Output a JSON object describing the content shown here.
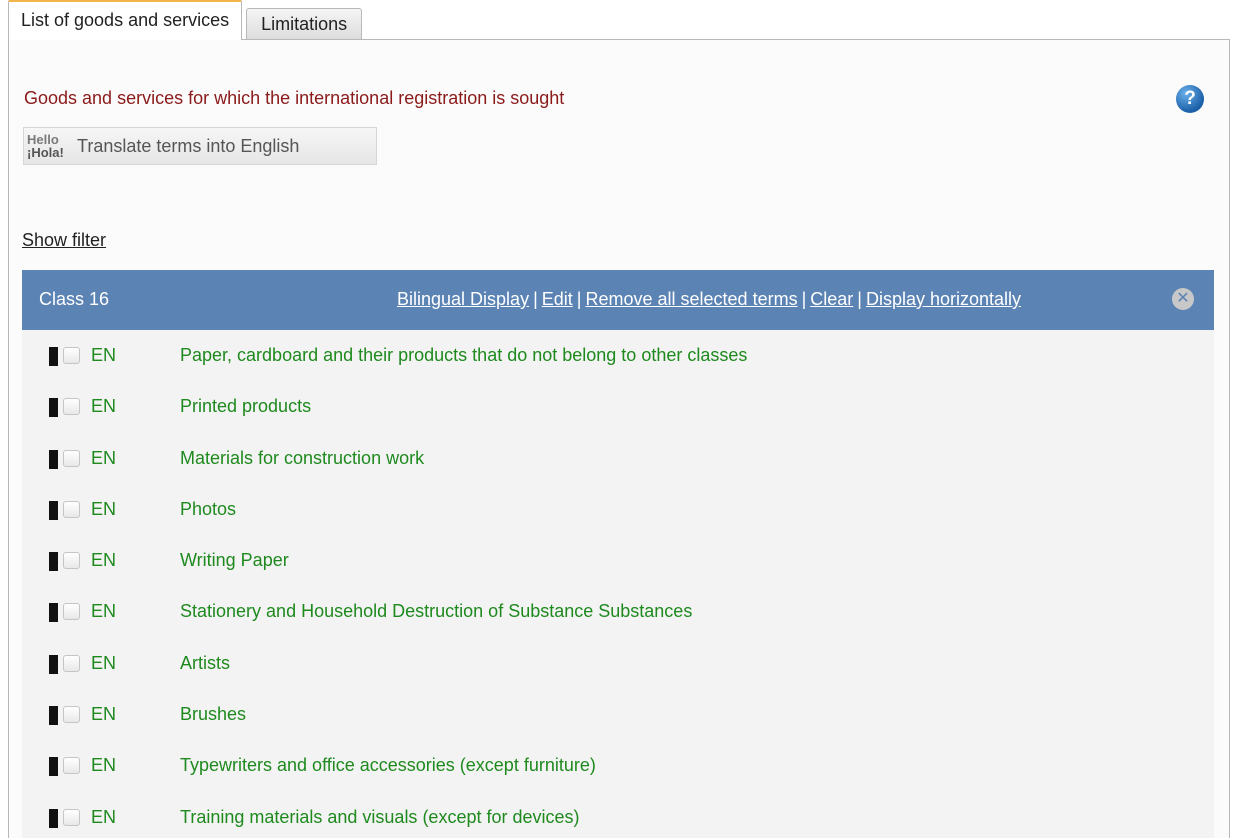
{
  "tabs": [
    {
      "label": "List of goods and services",
      "active": true
    },
    {
      "label": "Limitations",
      "active": false
    }
  ],
  "intro_text": "Goods and services for which the international registration is sought",
  "help_glyph": "?",
  "translate": {
    "icon_line1": "Hello",
    "icon_line2": "¡Hola!",
    "label": "Translate terms into English"
  },
  "show_filter": "Show filter",
  "class_bar": {
    "title": "Class 16",
    "actions": {
      "bilingual": "Bilingual Display",
      "edit": "Edit",
      "remove": "Remove all selected terms",
      "clear": "Clear",
      "horizontal": "Display horizontally"
    },
    "separator": "|",
    "close_glyph": "✕"
  },
  "terms": [
    {
      "lang": "EN",
      "text": "Paper, cardboard and their products that do not belong to other classes"
    },
    {
      "lang": "EN",
      "text": "Printed products"
    },
    {
      "lang": "EN",
      "text": "Materials for construction work"
    },
    {
      "lang": "EN",
      "text": "Photos"
    },
    {
      "lang": "EN",
      "text": "Writing Paper"
    },
    {
      "lang": "EN",
      "text": "Stationery and Household Destruction of Substance Substances"
    },
    {
      "lang": "EN",
      "text": "Artists"
    },
    {
      "lang": "EN",
      "text": "Brushes"
    },
    {
      "lang": "EN",
      "text": "Typewriters and office accessories (except furniture)"
    },
    {
      "lang": "EN",
      "text": "Training materials and visuals (except for devices)"
    }
  ],
  "colors": {
    "tab_accent": "#f1b54c",
    "intro_text": "#8b1a1a",
    "class_bar": "#5b84b4",
    "term_text": "#1e8a1e"
  }
}
